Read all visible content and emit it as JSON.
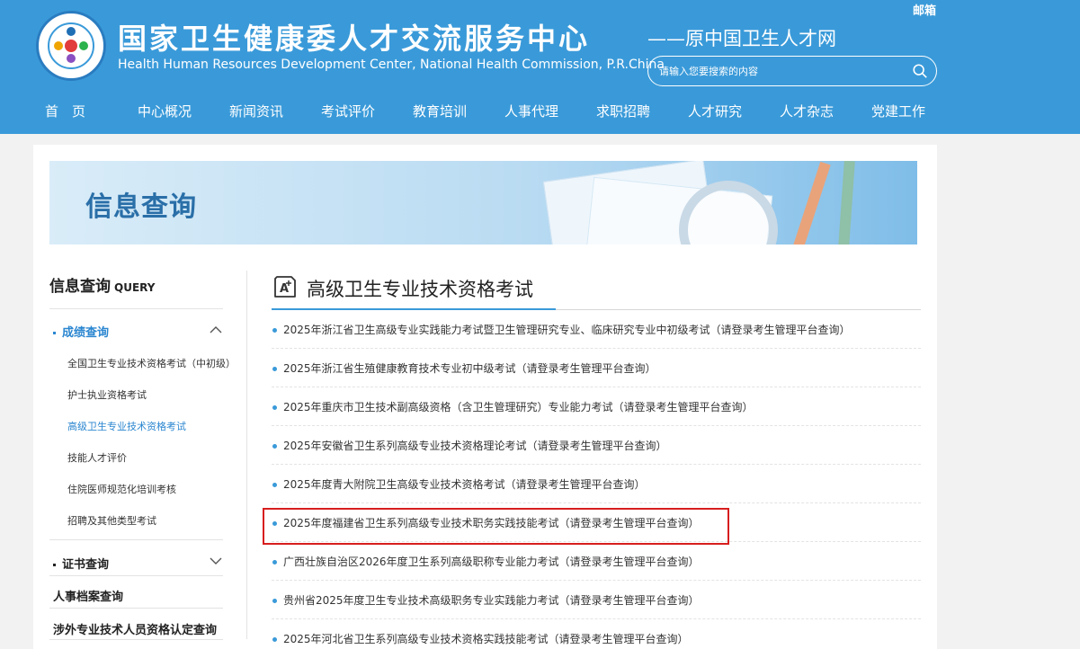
{
  "header": {
    "title_cn": "国家卫生健康委人才交流服务中心",
    "title_en": "Health Human Resources Development Center, National Health Commission, P.R.China",
    "subtitle": "——原中国卫生人才网",
    "mailbox": "邮箱",
    "search_placeholder": "请输入您要搜索的内容"
  },
  "nav": [
    "首　页",
    "中心概况",
    "新闻资讯",
    "考试评价",
    "教育培训",
    "人事代理",
    "求职招聘",
    "人才研究",
    "人才杂志",
    "党建工作"
  ],
  "banner": {
    "title": "信息查询"
  },
  "sidebar": {
    "title": "信息查询",
    "title_en": "QUERY",
    "group1": "成绩查询",
    "group1_items": [
      "全国卫生专业技术资格考试（中初级）",
      "护士执业资格考试",
      "高级卫生专业技术资格考试",
      "技能人才评价",
      "住院医师规范化培训考核",
      "招聘及其他类型考试"
    ],
    "group2": "证书查询",
    "plain_items": [
      "人事档案查询",
      "涉外专业技术人员资格认定查询"
    ]
  },
  "main": {
    "title": "高级卫生专业技术资格考试",
    "items": [
      "2025年浙江省卫生高级专业实践能力考试暨卫生管理研究专业、临床研究专业中初级考试（请登录考生管理平台查询）",
      "2025年浙江省生殖健康教育技术专业初中级考试（请登录考生管理平台查询）",
      "2025年重庆市卫生技术副高级资格（含卫生管理研究）专业能力考试（请登录考生管理平台查询）",
      "2025年安徽省卫生系列高级专业技术资格理论考试（请登录考生管理平台查询）",
      "2025年度青大附院卫生高级专业技术资格考试（请登录考生管理平台查询）",
      "2025年度福建省卫生系列高级专业技术职务实践技能考试（请登录考生管理平台查询）",
      "广西壮族自治区2026年度卫生系列高级职称专业能力考试（请登录考生管理平台查询）",
      "贵州省2025年度卫生专业技术高级职务专业实践能力考试（请登录考生管理平台查询）",
      "2025年河北省卫生系列高级专业技术资格实践技能考试（请登录考生管理平台查询）"
    ]
  },
  "colors": {
    "header_bg": "#3a9ad9",
    "accent": "#2a86d0",
    "highlight": "#d71e1e"
  }
}
